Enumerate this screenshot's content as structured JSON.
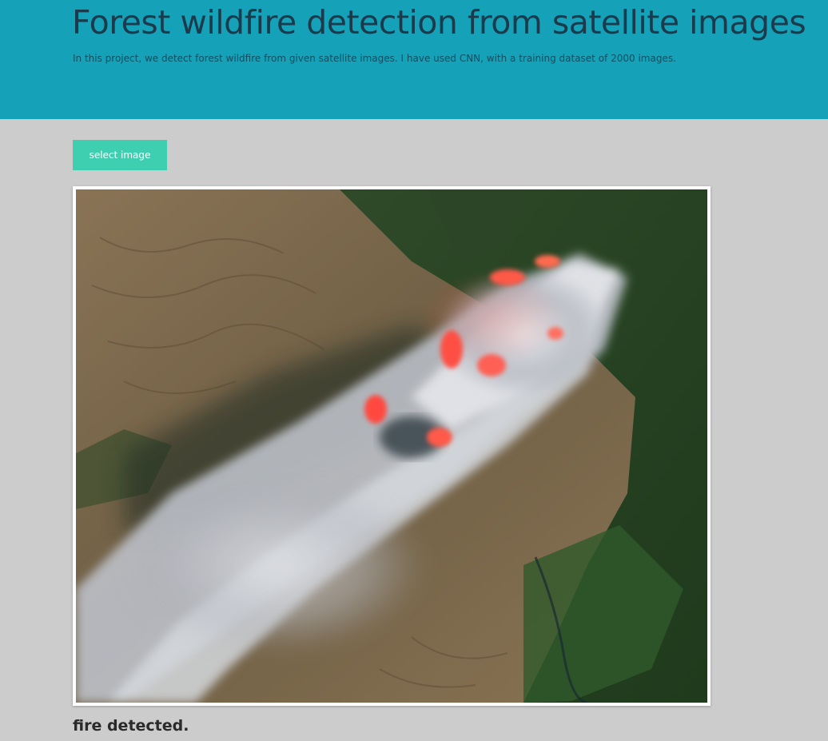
{
  "header": {
    "title": "Forest wildfire detection from satellite images",
    "subtitle": "In this project, we detect forest wildfire from given satellite images. I have used CNN, with a training dataset of 2000 images.",
    "background_color": "#15a1b8"
  },
  "upload": {
    "button_label": "select image",
    "button_color": "#3ecfb0"
  },
  "preview": {
    "image_description_icon": "satellite-wildfire-image"
  },
  "result": {
    "text": "fire detected."
  }
}
